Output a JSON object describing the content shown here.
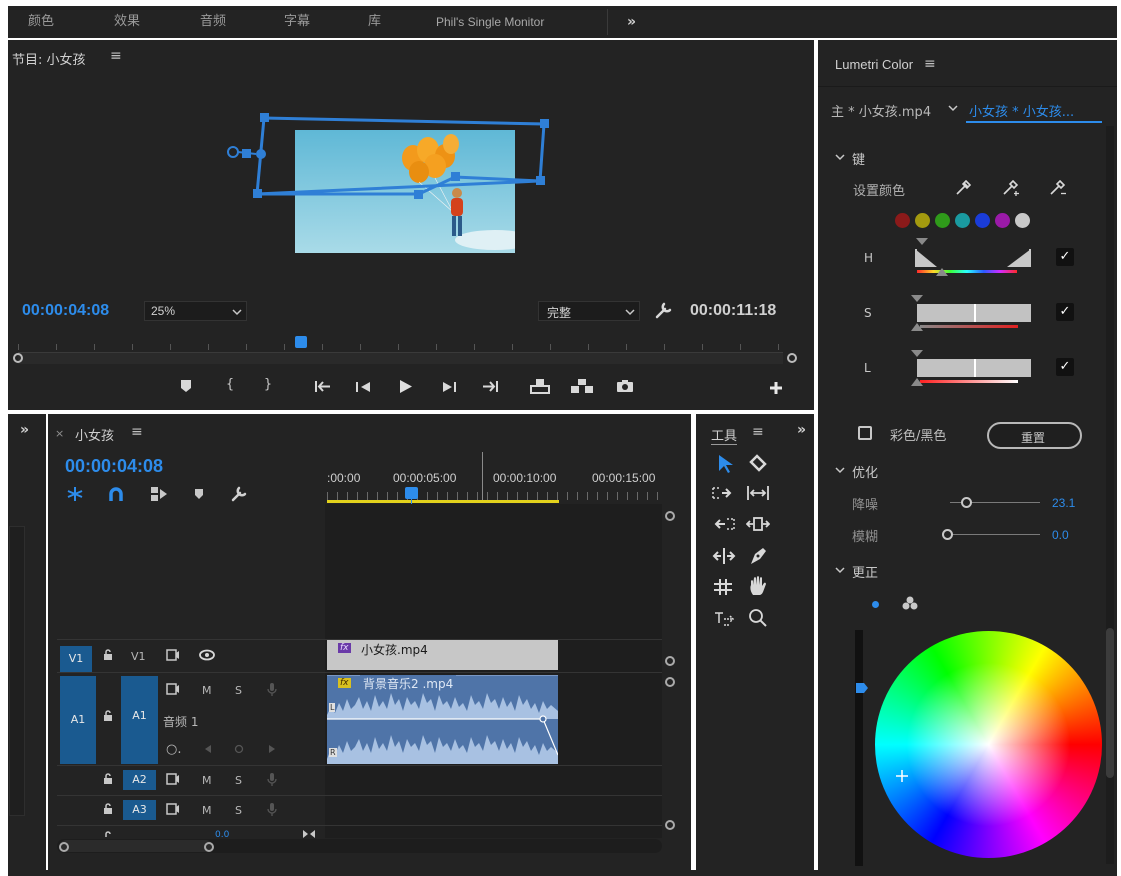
{
  "workspaces": {
    "tabs": [
      "颜色",
      "效果",
      "音频",
      "字幕",
      "库",
      "Phil's Single Monitor"
    ],
    "overflow": "»"
  },
  "program_monitor": {
    "title": "节目: 小女孩",
    "menu_glyph": "≡",
    "current_time": "00:00:04:08",
    "zoom": "25%",
    "quality": "完整",
    "duration": "00:00:11:18",
    "playhead_fraction": 0.37
  },
  "timeline": {
    "sequence_name": "小女孩",
    "close_glyph": "×",
    "menu_glyph": "≡",
    "collapse_glyph": "»",
    "current_time": "00:00:04:08",
    "ruler": [
      ":00:00",
      "00:00:05:00",
      "00:00:10:00",
      "00:00:15:00"
    ],
    "video_tracks": [
      {
        "source": "V1",
        "target": "V1",
        "clip": "小女孩.mp4",
        "fx": "fx"
      }
    ],
    "audio_tracks": [
      {
        "source": "A1",
        "target": "A1",
        "name": "音频 1",
        "clip": "背景音乐2 .mp4",
        "fx": "fx",
        "m": "M",
        "s": "S",
        "ch_l": "L",
        "ch_r": "R"
      },
      {
        "target": "A2",
        "m": "M",
        "s": "S"
      },
      {
        "target": "A3",
        "m": "M",
        "s": "S"
      }
    ],
    "volume_value": "0.0"
  },
  "tools": {
    "title": "工具",
    "menu_glyph": "≡",
    "collapse_glyph": "»"
  },
  "lumetri": {
    "title": "Lumetri Color",
    "menu_glyph": "≡",
    "master_clip": "主 * 小女孩.mp4",
    "seq_clip": "小女孩 * 小女孩...",
    "key_section": "键",
    "set_color": "设置颜色",
    "swatch_colors": [
      "#8b1a1a",
      "#a39a0f",
      "#2f9a1a",
      "#1a9aa0",
      "#1a3cd8",
      "#9a1aa8",
      "#c8c8c8"
    ],
    "hsl": [
      {
        "label": "H",
        "checked": true
      },
      {
        "label": "S",
        "checked": true
      },
      {
        "label": "L",
        "checked": true
      }
    ],
    "mono_label": "彩色/黑色",
    "reset_label": "重置",
    "refine_section": "优化",
    "denoise_label": "降噪",
    "denoise_value": "23.1",
    "blur_label": "模糊",
    "blur_value": "0.0",
    "correction_section": "更正"
  }
}
